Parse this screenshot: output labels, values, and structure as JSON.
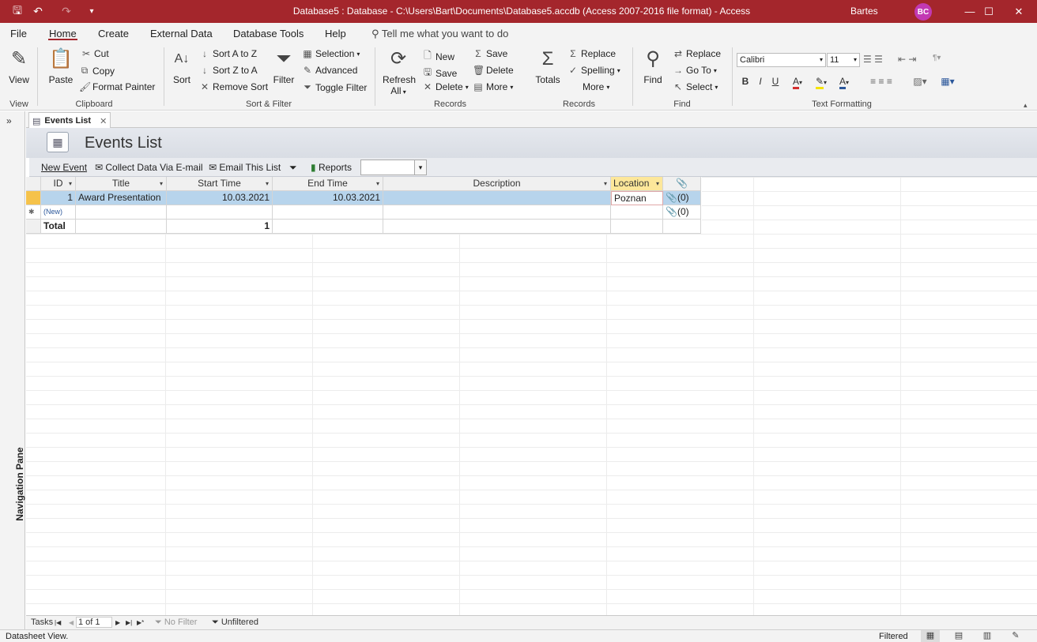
{
  "titlebar": {
    "title": "Database5 : Database - C:\\Users\\Bart\\Documents\\Database5.accdb (Access 2007-2016 file format)  -  Access",
    "user_name": "Bartes",
    "user_initials": "BC",
    "minimize": "—",
    "maximize": "☐",
    "close": "✕",
    "save_icon": "🖫",
    "undo_icon": "↶",
    "redo_icon": "↷",
    "customize_icon": "▾"
  },
  "menu": {
    "file": "File",
    "home": "Home",
    "create": "Create",
    "external_data": "External Data",
    "database_tools": "Database Tools",
    "help": "Help",
    "tell_me": "Tell me what you want to do"
  },
  "ribbon": {
    "view": {
      "label": "View",
      "group": "View"
    },
    "clipboard": {
      "paste": "Paste",
      "cut": "Cut",
      "copy": "Copy",
      "format_painter": "Format Painter",
      "group": "Clipboard"
    },
    "sort_filter": {
      "sort": "Sort",
      "sort_az": "Sort A to Z",
      "sort_za": "Sort Z to A",
      "remove_sort": "Remove Sort",
      "filter": "Filter",
      "selection": "Selection",
      "advanced": "Advanced",
      "toggle_filter": "Toggle Filter",
      "group": "Sort & Filter"
    },
    "records": {
      "refresh": "Refresh",
      "refresh_all": "All",
      "new": "New",
      "save": "Save",
      "delete": "Delete",
      "totals": "Totals",
      "spelling": "Spelling",
      "more": "More",
      "save2": "Save",
      "delete2": "Delete",
      "group": "Records"
    },
    "find": {
      "find": "Find",
      "replace": "Replace",
      "go_to": "Go To",
      "select": "Select",
      "group": "Find"
    },
    "text_formatting": {
      "font": "Calibri",
      "size": "11",
      "bold": "B",
      "italic": "I",
      "underline": "U",
      "group": "Text Formatting"
    },
    "records_replace": "Replace"
  },
  "navpane": {
    "label": "Navigation Pane",
    "toggle": "»"
  },
  "doc_tab": {
    "label": "Events List",
    "close": "✕"
  },
  "form": {
    "title": "Events List",
    "toolbar": {
      "new_event": "New Event",
      "collect_data": "Collect Data Via E-mail",
      "email_list": "Email This List",
      "reports": "Reports"
    }
  },
  "grid": {
    "headers": [
      "ID",
      "Title",
      "Start Time",
      "End Time",
      "Description",
      "Location",
      "📎"
    ],
    "rows": [
      {
        "id": "1",
        "title": "Award Presentation",
        "start": "10.03.2021",
        "end": "10.03.2021",
        "description": "",
        "location": "Poznan",
        "attach": "📎(0)"
      }
    ],
    "new_row": {
      "id": "(New)",
      "attach": "📎(0)"
    },
    "total": {
      "label": "Total",
      "count": "1"
    }
  },
  "recnav": {
    "tasks": "Tasks",
    "first": "◀",
    "position": "1 of 1",
    "next": "▶",
    "last": "▶|",
    "new": "▶*",
    "no_filter": "No Filter",
    "unfiltered": "Unfiltered"
  },
  "status": {
    "left": "Datasheet View.",
    "filtered": "Filtered"
  }
}
